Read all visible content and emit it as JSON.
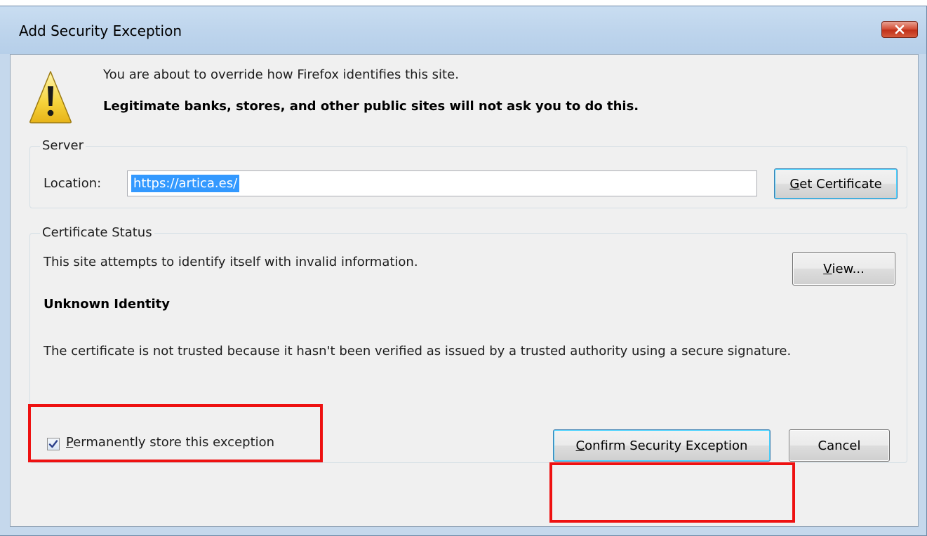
{
  "window": {
    "title": "Add Security Exception",
    "close_icon": "close-x-icon"
  },
  "warning": {
    "icon": "warning-triangle-icon",
    "line1": "You are about to override how Firefox identifies this site.",
    "line2": "Legitimate banks, stores, and other public sites will not ask you to do this."
  },
  "server": {
    "legend": "Server",
    "location_label": "Location:",
    "location_value": "https://artica.es/",
    "get_certificate_accel": "G",
    "get_certificate_rest": "et Certificate"
  },
  "status": {
    "legend": "Certificate Status",
    "summary": "This site attempts to identify itself with invalid information.",
    "view_accel": "V",
    "view_rest": "iew...",
    "identity_heading": "Unknown Identity",
    "identity_detail": "The certificate is not trusted because it hasn't been verified as issued by a trusted authority using a secure signature.",
    "permanent_accel": "P",
    "permanent_rest": "ermanently store this exception",
    "permanent_checked": true
  },
  "buttons": {
    "confirm_accel": "C",
    "confirm_rest": "onfirm Security Exception",
    "cancel": "Cancel"
  },
  "colors": {
    "highlight_box": "#ee1111",
    "selection": "#3399ff"
  }
}
